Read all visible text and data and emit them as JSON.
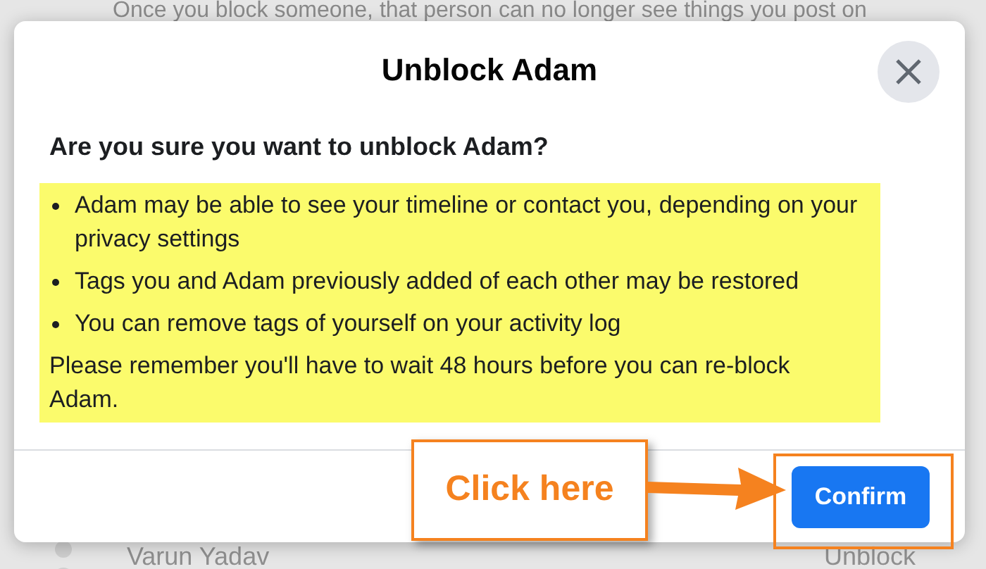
{
  "background": {
    "description": "Once you block someone, that person can no longer see things you post on",
    "blocked_users": [
      {
        "name": "Varun Yadav",
        "action": "Unblock"
      }
    ]
  },
  "dialog": {
    "title": "Unblock Adam",
    "question": "Are you sure you want to unblock Adam?",
    "bullets": [
      "Adam may be able to see your timeline or contact you, depending on your privacy settings",
      "Tags you and Adam previously added of each other may be restored",
      "You can remove tags of yourself on your activity log"
    ],
    "note": "Please remember you'll have to wait 48 hours before you can re-block Adam.",
    "confirm": "Confirm"
  },
  "annotation": {
    "callout": "Click here"
  }
}
